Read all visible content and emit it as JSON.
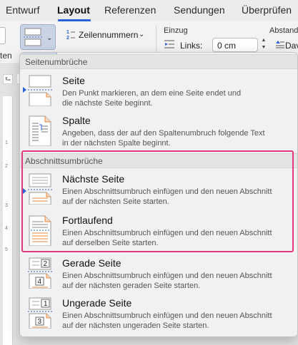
{
  "ribbon_tabs": {
    "t1": "Entwurf",
    "t2": "Layout",
    "t3": "Referenzen",
    "t4": "Sendungen",
    "t5": "Überprüfen"
  },
  "ribbon": {
    "left_label": "ten",
    "line_numbers_label": "Zeilennummern",
    "line_numbers_icon": "1\n2",
    "einzug_label": "Einzug",
    "abstand_label": "Abstand",
    "links_label": "Links:",
    "links_value": "0 cm",
    "vor_label": "Dav"
  },
  "ruler": {
    "corner": "⮑",
    "n1": "1",
    "n2": "2",
    "n3": "3",
    "n4": "4",
    "n5": "5"
  },
  "menu": {
    "section_page": "Seitenumbrüche",
    "section_section": "Abschnittsumbrüche",
    "items": [
      {
        "title": "Seite",
        "desc": "Den Punkt markieren, an dem eine Seite endet und\ndie nächste Seite beginnt.",
        "icon": "page-break-icon"
      },
      {
        "title": "Spalte",
        "desc": "Angeben, dass der auf den Spaltenumbruch folgende Text\nin der nächsten Spalte beginnt.",
        "icon": "column-break-icon"
      },
      {
        "title": "Nächste Seite",
        "desc": "Einen Abschnittsumbruch einfügen und den neuen Abschnitt\nauf der nächsten Seite starten.",
        "icon": "next-page-break-icon"
      },
      {
        "title": "Fortlaufend",
        "desc": "Einen Abschnittsumbruch einfügen und den neuen Abschnitt\nauf derselben Seite starten.",
        "icon": "continuous-break-icon"
      },
      {
        "title": "Gerade Seite",
        "desc": "Einen Abschnittsumbruch einfügen und den neuen Abschnitt\nauf der nächsten geraden Seite starten.",
        "icon": "even-page-break-icon",
        "icon_numbers": [
          "2",
          "4"
        ]
      },
      {
        "title": "Ungerade Seite",
        "desc": "Einen Abschnittsumbruch einfügen und den neuen Abschnitt\nauf der nächsten ungeraden Seite starten.",
        "icon": "odd-page-break-icon",
        "icon_numbers": [
          "1",
          "3"
        ]
      }
    ]
  },
  "colors": {
    "accent": "#2b62d6",
    "highlight": "#e0397e",
    "icon_orange": "#e8873a"
  }
}
